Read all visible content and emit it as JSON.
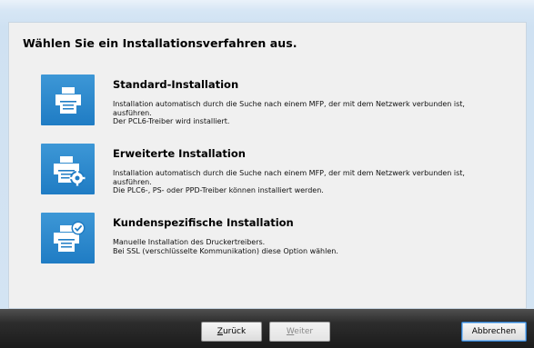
{
  "heading": "Wählen Sie ein Installationsverfahren aus.",
  "options": [
    {
      "title": "Standard-Installation",
      "description": [
        "Installation automatisch durch die Suche nach einem MFP, der mit dem Netzwerk verbunden ist,",
        "ausführen.",
        "Der PCL6-Treiber wird installiert."
      ],
      "icon": "printer-icon"
    },
    {
      "title": "Erweiterte Installation",
      "description": [
        "Installation automatisch durch die Suche nach einem MFP, der mit dem Netzwerk verbunden ist,",
        "ausführen.",
        "Die PLC6-, PS- oder PPD-Treiber können installiert werden."
      ],
      "icon": "printer-gear-icon"
    },
    {
      "title": "Kundenspezifische Installation",
      "description": [
        "Manuelle Installation des Druckertreibers.",
        "Bei SSL (verschlüsselte Kommunikation) diese Option wählen."
      ],
      "icon": "printer-check-icon"
    }
  ],
  "buttons": {
    "back": {
      "mnemonic": "Z",
      "rest": "urück"
    },
    "next": {
      "mnemonic": "W",
      "rest": "eiter"
    },
    "cancel": "Abbrechen"
  },
  "colors": {
    "tile": "#1f7cc4",
    "footer": "#1b1b1b",
    "panel": "#f0f0f0"
  }
}
